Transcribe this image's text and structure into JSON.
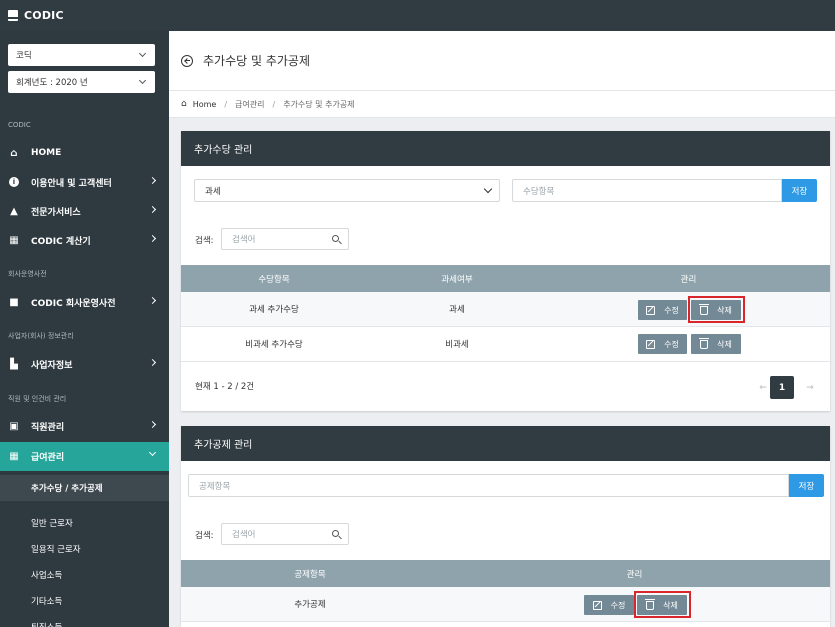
{
  "app": {
    "brand": "CODIC"
  },
  "sidebar": {
    "company_select": "코딕",
    "year_select": "회계년도 : 2020 년",
    "sections": [
      "CODIC",
      "회사운영사전",
      "사업자(회사) 정보관리",
      "직원 및 인건비 관리"
    ],
    "items": [
      {
        "label": "HOME",
        "icon": "home-icon"
      },
      {
        "label": "이용안내 및 고객센터",
        "icon": "info-icon"
      },
      {
        "label": "전문가서비스",
        "icon": "graduation-cap-icon"
      },
      {
        "label": "CODIC 계산기",
        "icon": "calculator-icon"
      },
      {
        "label": "CODIC 회사운영사전",
        "icon": "book-icon"
      },
      {
        "label": "사업자정보",
        "icon": "building-icon"
      },
      {
        "label": "직원관리",
        "icon": "id-card-icon"
      },
      {
        "label": "급여관리",
        "icon": "grid-icon"
      }
    ],
    "subitems": [
      "추가수당 / 추가공제",
      "일반 근로자",
      "일용직 근로자",
      "사업소득",
      "기타소득",
      "퇴직소득"
    ]
  },
  "page": {
    "title": "추가수당 및 추가공제"
  },
  "breadcrumb": [
    "Home",
    "급여관리",
    "추가수당 및 추가공제"
  ],
  "allowance": {
    "title": "추가수당 관리",
    "tax_select": "과세",
    "item_placeholder": "수당항목",
    "save_label": "저장",
    "search_label": "검색:",
    "search_placeholder": "검색어",
    "columns": [
      "수당항목",
      "과세여부",
      "관리"
    ],
    "rows": [
      {
        "name": "과세 추가수당",
        "tax": "과세"
      },
      {
        "name": "비과세 추가수당",
        "tax": "비과세"
      }
    ],
    "edit_label": "수정",
    "delete_label": "삭제",
    "footer": "현재 1 - 2 / 2건",
    "page": "1",
    "prev": "←",
    "next": "→"
  },
  "deduction": {
    "title": "추가공제 관리",
    "item_placeholder": "공제항목",
    "save_label": "저장",
    "search_label": "검색:",
    "search_placeholder": "검색어",
    "columns": [
      "공제항목",
      "관리"
    ],
    "rows": [
      {
        "name": "추가공제"
      }
    ],
    "edit_label": "수정",
    "delete_label": "삭제"
  },
  "colors": {
    "sidebar": "#2f3a40",
    "accent": "#26a69a",
    "header": "#313b42",
    "button": "#738995",
    "save": "#2e9ae6",
    "highlight": "#d9262c"
  }
}
